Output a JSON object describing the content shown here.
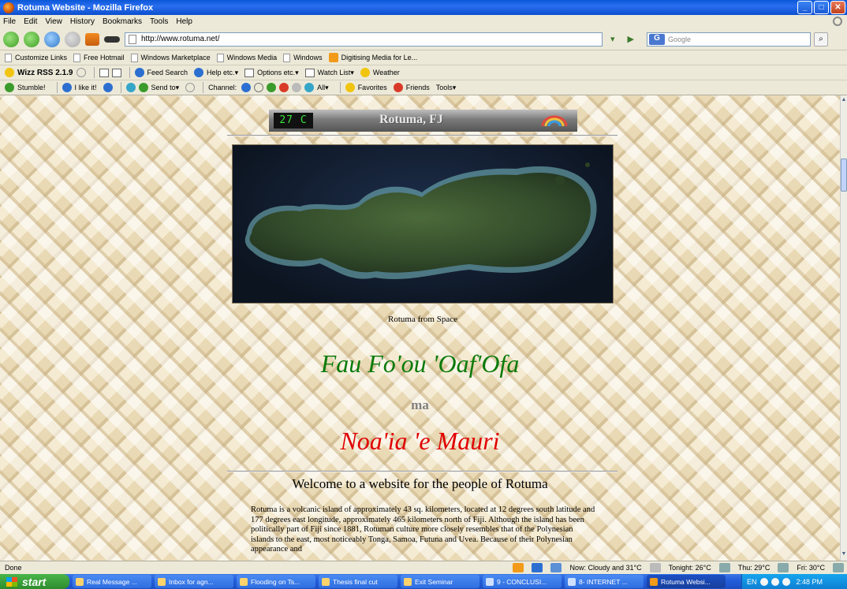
{
  "window": {
    "title": "Rotuma Website - Mozilla Firefox"
  },
  "menu": [
    "File",
    "Edit",
    "View",
    "History",
    "Bookmarks",
    "Tools",
    "Help"
  ],
  "nav": {
    "url": "http://www.rotuma.net/",
    "search_placeholder": "Google",
    "search_engine": "G"
  },
  "links_toolbar": [
    "Customize Links",
    "Free Hotmail",
    "Windows Marketplace",
    "Windows Media",
    "Windows",
    "Digitising Media for Le..."
  ],
  "wizz_toolbar": {
    "name": "Wizz RSS 2.1.9",
    "items": [
      "Feed Search",
      "Help etc.",
      "Options etc.",
      "Watch List",
      "Weather"
    ]
  },
  "stumble_toolbar": {
    "items": [
      "Stumble!",
      "I like it!",
      "Send to",
      "Channel:",
      "All",
      "Favorites",
      "Friends",
      "Tools"
    ]
  },
  "page": {
    "banner": {
      "temperature": "27 C",
      "location": "Rotuma, FJ"
    },
    "image_caption": "Rotuma from Space",
    "heading_green": "Fau Fo'ou 'Oaf'Ofa",
    "heading_ma": "ma",
    "heading_red": "Noa'ia 'e Mauri",
    "welcome": "Welcome to a website for the people of Rotuma",
    "paragraph": "Rotuma is a volcanic island of approximately 43 sq. kilometers, located at 12 degrees south latitude and 177 degrees east longitude, approximately 465 kilometers north of Fiji. Although the island has been politically part of Fiji since 1881, Rotuman culture more closely resembles that of the Polynesian islands to the east, most noticeably Tonga, Samoa, Futuna and Uvea. Because of their Polynesian appearance and"
  },
  "status": {
    "text": "Done",
    "weather_now": "Now: Cloudy and 31°C",
    "tonight": "Tonight: 26°C",
    "thu": "Thu: 29°C",
    "fri": "Fri: 30°C"
  },
  "taskbar": {
    "start": "start",
    "tasks": [
      "Real Message ...",
      "Inbox for agn...",
      "Flooding on Ts...",
      "Thesis final cut",
      "Exit Seminar",
      "9 - CONCLUSI...",
      "8- INTERNET ...",
      "Rotuma Websi..."
    ],
    "tray_lang": "EN",
    "clock": "2:48 PM"
  }
}
